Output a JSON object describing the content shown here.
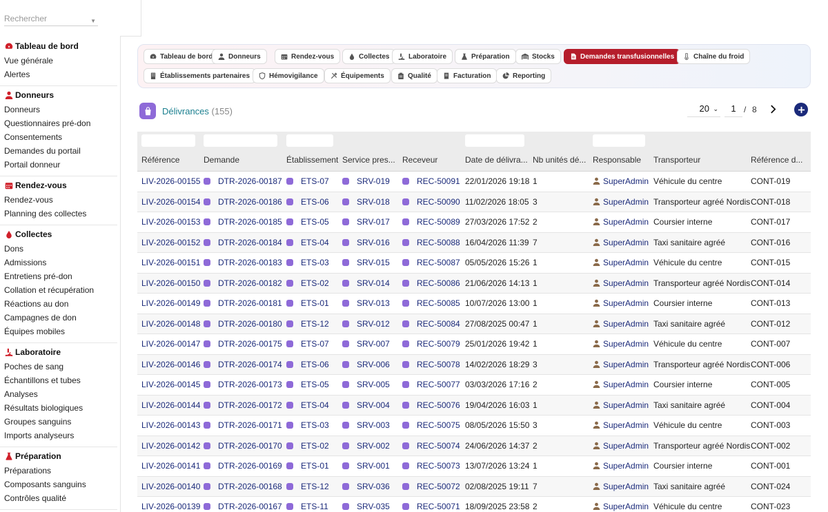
{
  "sidebar": {
    "search_placeholder": "Rechercher",
    "sections": [
      {
        "title": "Tableau de bord",
        "icon": "gauge-icon",
        "items": [
          "Vue générale",
          "Alertes"
        ]
      },
      {
        "title": "Donneurs",
        "icon": "user-icon",
        "items": [
          "Donneurs",
          "Questionnaires pré-don",
          "Consentements",
          "Demandes du portail",
          "Portail donneur"
        ]
      },
      {
        "title": "Rendez-vous",
        "icon": "calendar-icon",
        "items": [
          "Rendez-vous",
          "Planning des collectes"
        ]
      },
      {
        "title": "Collectes",
        "icon": "drop-icon",
        "items": [
          "Dons",
          "Admissions",
          "Entretiens pré-don",
          "Collation et récupération",
          "Réactions au don",
          "Campagnes de don",
          "Équipes mobiles"
        ]
      },
      {
        "title": "Laboratoire",
        "icon": "microscope-icon",
        "items": [
          "Poches de sang",
          "Échantillons et tubes",
          "Analyses",
          "Résultats biologiques",
          "Groupes sanguins",
          "Imports analyseurs"
        ]
      },
      {
        "title": "Préparation",
        "icon": "flask-icon",
        "items": [
          "Préparations",
          "Composants sanguins",
          "Contrôles qualité"
        ]
      }
    ]
  },
  "modules": [
    {
      "label": "Tableau de bord",
      "icon": "gauge-icon"
    },
    {
      "label": "Donneurs",
      "icon": "user-icon"
    },
    {
      "label": "Rendez-vous",
      "icon": "calendar-icon"
    },
    {
      "label": "Collectes",
      "icon": "drop-icon"
    },
    {
      "label": "Laboratoire",
      "icon": "microscope-icon"
    },
    {
      "label": "Préparation",
      "icon": "flask-icon"
    },
    {
      "label": "Stocks",
      "icon": "warehouse-icon"
    },
    {
      "label": "Demandes transfusionnelles",
      "icon": "file-icon",
      "active": true
    },
    {
      "label": "Chaîne du froid",
      "icon": "thermometer-icon"
    },
    {
      "label": "Établissements partenaires",
      "icon": "building-icon"
    },
    {
      "label": "Hémovigilance",
      "icon": "shield-icon"
    },
    {
      "label": "Équipements",
      "icon": "tools-icon"
    },
    {
      "label": "Qualité",
      "icon": "clipboard-icon"
    },
    {
      "label": "Facturation",
      "icon": "invoice-icon"
    },
    {
      "label": "Reporting",
      "icon": "chart-pie-icon"
    }
  ],
  "list": {
    "title": "Délivrances",
    "count": "(155)",
    "page_size": "20",
    "page": "1",
    "page_sep": "/",
    "total_pages": "8"
  },
  "columns": [
    "Référence",
    "Demande",
    "Établissement",
    "Service pres...",
    "Receveur",
    "Date de délivra...",
    "Nb unités dé...",
    "Responsable",
    "Transporteur",
    "Référence d..."
  ],
  "rows": [
    [
      "LIV-2026-00155",
      "DTR-2026-00187",
      "ETS-07",
      "SRV-019",
      "REC-50091",
      "22/01/2026 19:18",
      "1",
      "SuperAdmin",
      "Véhicule du centre",
      "CONT-019"
    ],
    [
      "LIV-2026-00154",
      "DTR-2026-00186",
      "ETS-06",
      "SRV-018",
      "REC-50090",
      "11/02/2026 18:05",
      "3",
      "SuperAdmin",
      "Transporteur agréé Nordis",
      "CONT-018"
    ],
    [
      "LIV-2026-00153",
      "DTR-2026-00185",
      "ETS-05",
      "SRV-017",
      "REC-50089",
      "27/03/2026 17:52",
      "2",
      "SuperAdmin",
      "Coursier interne",
      "CONT-017"
    ],
    [
      "LIV-2026-00152",
      "DTR-2026-00184",
      "ETS-04",
      "SRV-016",
      "REC-50088",
      "16/04/2026 11:39",
      "7",
      "SuperAdmin",
      "Taxi sanitaire agréé",
      "CONT-016"
    ],
    [
      "LIV-2026-00151",
      "DTR-2026-00183",
      "ETS-03",
      "SRV-015",
      "REC-50087",
      "05/05/2026 15:26",
      "1",
      "SuperAdmin",
      "Véhicule du centre",
      "CONT-015"
    ],
    [
      "LIV-2026-00150",
      "DTR-2026-00182",
      "ETS-02",
      "SRV-014",
      "REC-50086",
      "21/06/2026 14:13",
      "1",
      "SuperAdmin",
      "Transporteur agréé Nordis",
      "CONT-014"
    ],
    [
      "LIV-2026-00149",
      "DTR-2026-00181",
      "ETS-01",
      "SRV-013",
      "REC-50085",
      "10/07/2026 13:00",
      "1",
      "SuperAdmin",
      "Coursier interne",
      "CONT-013"
    ],
    [
      "LIV-2026-00148",
      "DTR-2026-00180",
      "ETS-12",
      "SRV-012",
      "REC-50084",
      "27/08/2025 00:47",
      "1",
      "SuperAdmin",
      "Taxi sanitaire agréé",
      "CONT-012"
    ],
    [
      "LIV-2026-00147",
      "DTR-2026-00175",
      "ETS-07",
      "SRV-007",
      "REC-50079",
      "25/01/2026 19:42",
      "1",
      "SuperAdmin",
      "Véhicule du centre",
      "CONT-007"
    ],
    [
      "LIV-2026-00146",
      "DTR-2026-00174",
      "ETS-06",
      "SRV-006",
      "REC-50078",
      "14/02/2026 18:29",
      "3",
      "SuperAdmin",
      "Transporteur agréé Nordis",
      "CONT-006"
    ],
    [
      "LIV-2026-00145",
      "DTR-2026-00173",
      "ETS-05",
      "SRV-005",
      "REC-50077",
      "03/03/2026 17:16",
      "2",
      "SuperAdmin",
      "Coursier interne",
      "CONT-005"
    ],
    [
      "LIV-2026-00144",
      "DTR-2026-00172",
      "ETS-04",
      "SRV-004",
      "REC-50076",
      "19/04/2026 16:03",
      "1",
      "SuperAdmin",
      "Taxi sanitaire agréé",
      "CONT-004"
    ],
    [
      "LIV-2026-00143",
      "DTR-2026-00171",
      "ETS-03",
      "SRV-003",
      "REC-50075",
      "08/05/2026 15:50",
      "3",
      "SuperAdmin",
      "Véhicule du centre",
      "CONT-003"
    ],
    [
      "LIV-2026-00142",
      "DTR-2026-00170",
      "ETS-02",
      "SRV-002",
      "REC-50074",
      "24/06/2026 14:37",
      "2",
      "SuperAdmin",
      "Transporteur agréé Nordis",
      "CONT-002"
    ],
    [
      "LIV-2026-00141",
      "DTR-2026-00169",
      "ETS-01",
      "SRV-001",
      "REC-50073",
      "13/07/2026 13:24",
      "1",
      "SuperAdmin",
      "Coursier interne",
      "CONT-001"
    ],
    [
      "LIV-2026-00140",
      "DTR-2026-00168",
      "ETS-12",
      "SRV-036",
      "REC-50072",
      "02/08/2025 19:11",
      "7",
      "SuperAdmin",
      "Taxi sanitaire agréé",
      "CONT-024"
    ],
    [
      "LIV-2026-00139",
      "DTR-2026-00167",
      "ETS-11",
      "SRV-035",
      "REC-50071",
      "18/09/2025 23:58",
      "2",
      "SuperAdmin",
      "Véhicule du centre",
      "CONT-023"
    ]
  ],
  "colors": {
    "accent_red": "#b51d2b",
    "link": "#1b2a7a",
    "title_teal": "#1a7f8f",
    "badge_purple": "#8e6ad8"
  }
}
